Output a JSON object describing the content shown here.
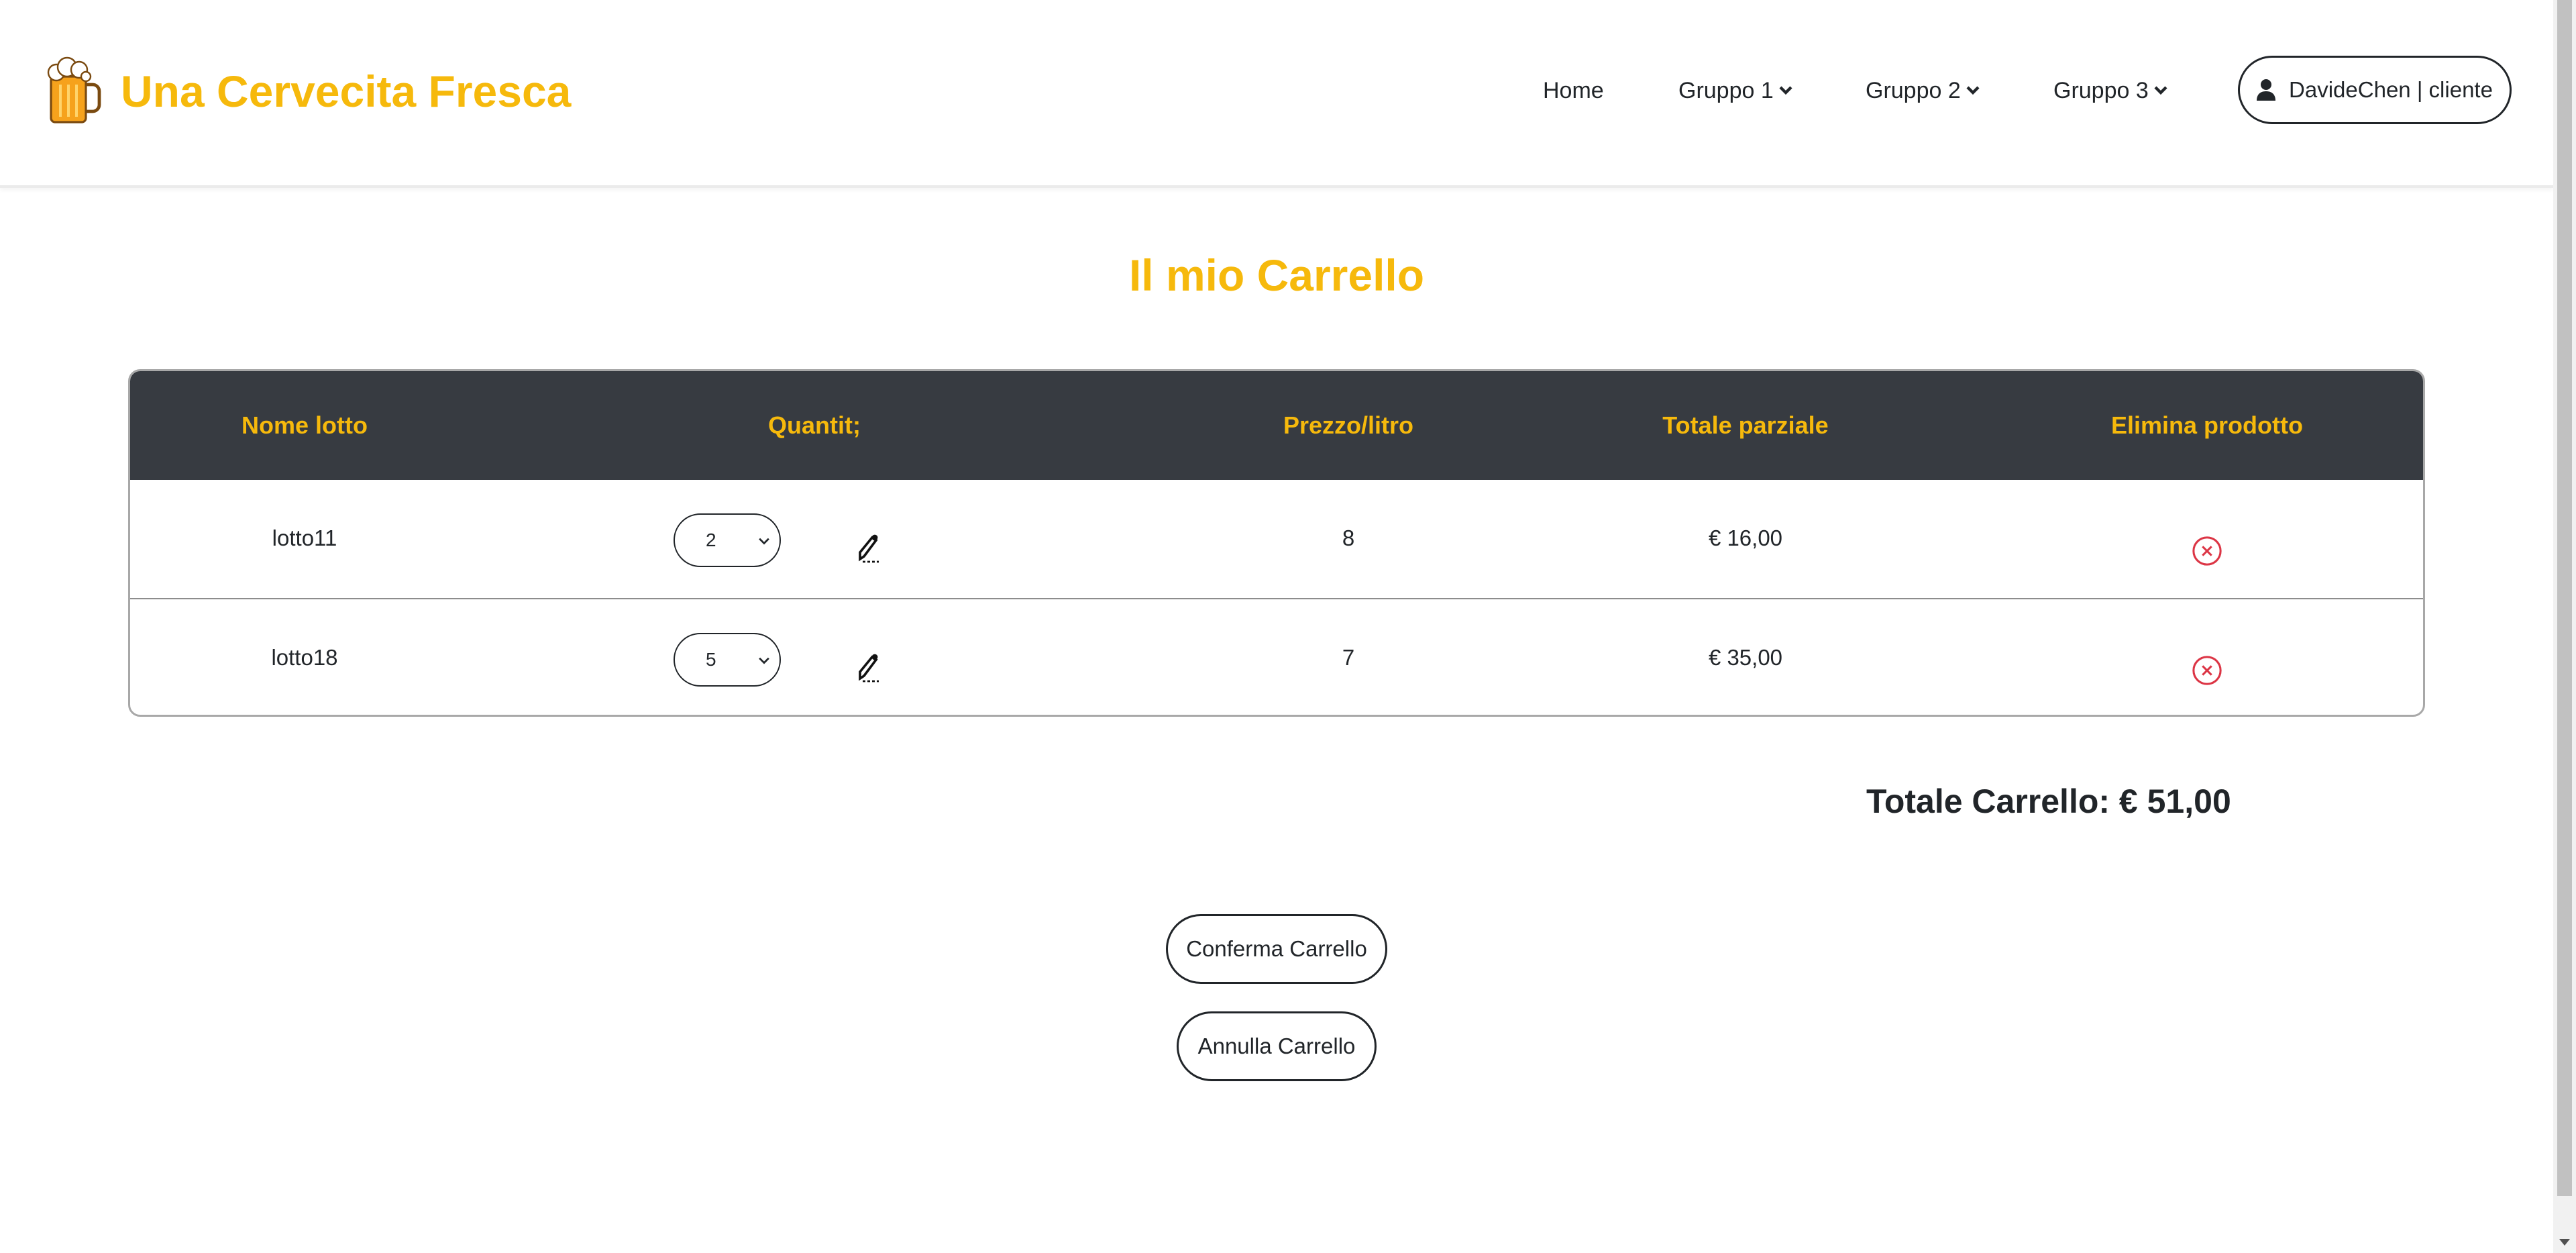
{
  "header": {
    "brand_name": "Una Cervecita Fresca",
    "brand_icon": "beer-mug-icon",
    "nav": [
      {
        "label": "Home",
        "dropdown": false
      },
      {
        "label": "Gruppo 1",
        "dropdown": true
      },
      {
        "label": "Gruppo 2",
        "dropdown": true
      },
      {
        "label": "Gruppo 3",
        "dropdown": true
      }
    ],
    "user_label": "DavideChen | cliente",
    "user_icon": "user-icon"
  },
  "page": {
    "title": "Il mio Carrello"
  },
  "cart": {
    "headers": [
      "Nome lotto",
      "Quantit;",
      "Prezzo/litro",
      "Totale parziale",
      "Elimina prodotto"
    ],
    "rows": [
      {
        "name": "lotto11",
        "quantity": "2",
        "price": "8",
        "subtotal": "€ 16,00"
      },
      {
        "name": "lotto18",
        "quantity": "5",
        "price": "7",
        "subtotal": "€ 35,00"
      }
    ],
    "total_label": "Totale Carrello: € 51,00"
  },
  "actions": {
    "confirm_label": "Conferma Carrello",
    "cancel_label": "Annulla Carrello"
  },
  "colors": {
    "accent": "#f6b90c",
    "table_header_bg": "#373b41",
    "delete": "#dc3545"
  }
}
